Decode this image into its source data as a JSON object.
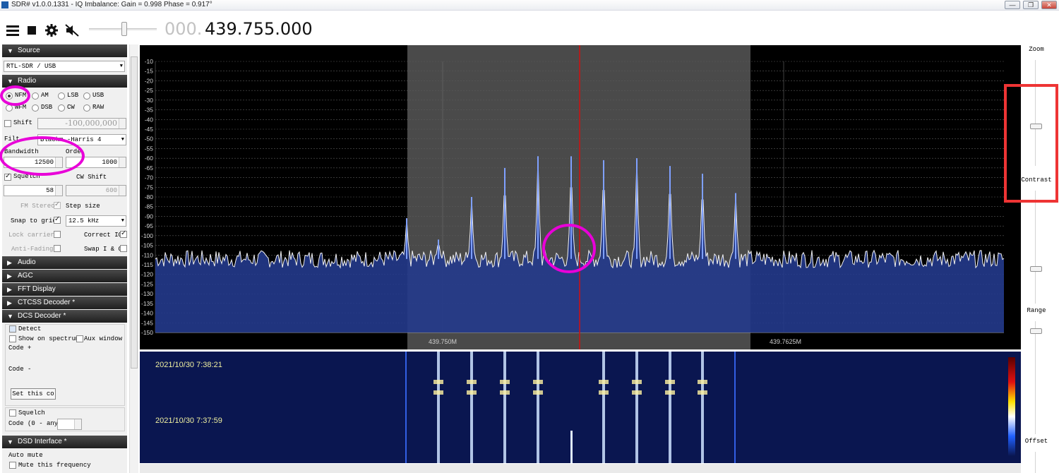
{
  "window": {
    "title": "SDR# v1.0.0.1331 - IQ Imbalance: Gain = 0.998 Phase = 0.917°",
    "min": "—",
    "max": "❐",
    "close": "✕"
  },
  "toolbar": {
    "freq_dim": "000.",
    "freq_main": "439.755.000",
    "icons": [
      "menu-icon",
      "stop-icon",
      "gear-icon",
      "mute-icon"
    ]
  },
  "source": {
    "header": "Source",
    "device": "RTL-SDR / USB"
  },
  "radio": {
    "header": "Radio",
    "modes": [
      {
        "label": "NFM",
        "selected": true
      },
      {
        "label": "AM"
      },
      {
        "label": "LSB"
      },
      {
        "label": "USB"
      },
      {
        "label": "WFM"
      },
      {
        "label": "DSB"
      },
      {
        "label": "CW"
      },
      {
        "label": "RAW"
      }
    ],
    "shift_label": "Shift",
    "shift_value": "-100,000,000",
    "filter_label": "Filt",
    "filter_value": "Blackm",
    "filter_value2": "-Harris 4",
    "bandwidth_label": "Bandwidth",
    "bandwidth_value": "12500",
    "order_label": "Orde",
    "order_value": "1000",
    "squelch_label": "Squelch",
    "squelch_value": "58",
    "cwshift_label": "CW Shift",
    "cwshift_value": "600",
    "fmstereo_label": "FM Stereo",
    "stepsize_label": "Step size",
    "snap_label": "Snap to grid",
    "snap_value": "12.5 kHz",
    "lockcarrier_label": "Lock carrier",
    "correctiq_label": "Correct IQ",
    "antifading_label": "Anti-Fading",
    "swapiq_label": "Swap I & Q"
  },
  "panels": [
    "Audio",
    "AGC",
    "FFT Display",
    "CTCSS Decoder *"
  ],
  "dcs": {
    "header": "DCS Decoder *",
    "detect": "Detect",
    "show_spectrum": "Show on spectrum",
    "aux_window": "Aux window",
    "code_plus": "Code +",
    "code_minus": "Code -",
    "set_button": "Set this co",
    "squelch": "Squelch",
    "code_range": "Code (0 - any)"
  },
  "dsd": {
    "header": "DSD Interface *",
    "auto_mute": "Auto mute",
    "mute_freq": "Mute this frequency"
  },
  "spectrum": {
    "y_labels": [
      "-10",
      "-15",
      "-20",
      "-25",
      "-30",
      "-35",
      "-40",
      "-45",
      "-50",
      "-55",
      "-60",
      "-65",
      "-70",
      "-75",
      "-80",
      "-85",
      "-90",
      "-95",
      "-100",
      "-105",
      "-110",
      "-115",
      "-120",
      "-125",
      "-130",
      "-135",
      "-140",
      "-145",
      "-150"
    ],
    "x_labels": [
      "439.750M",
      "439.7625M"
    ],
    "peak_db": [
      -91,
      -102,
      -80,
      -65,
      -59,
      -59,
      -61,
      -60,
      -64,
      -68,
      -78,
      -94
    ]
  },
  "waterfall": {
    "timestamps": [
      "2021/10/30 7:38:21",
      "2021/10/30 7:37:59"
    ]
  },
  "right": {
    "zoom": "Zoom",
    "contrast": "Contrast",
    "range": "Range",
    "offset": "Offset"
  },
  "colors": {
    "accent_red": "#ee3434",
    "highlight_magenta": "#e800d8",
    "spectrum_fill": "#233a8c",
    "waterfall_bg": "#0a1650"
  }
}
